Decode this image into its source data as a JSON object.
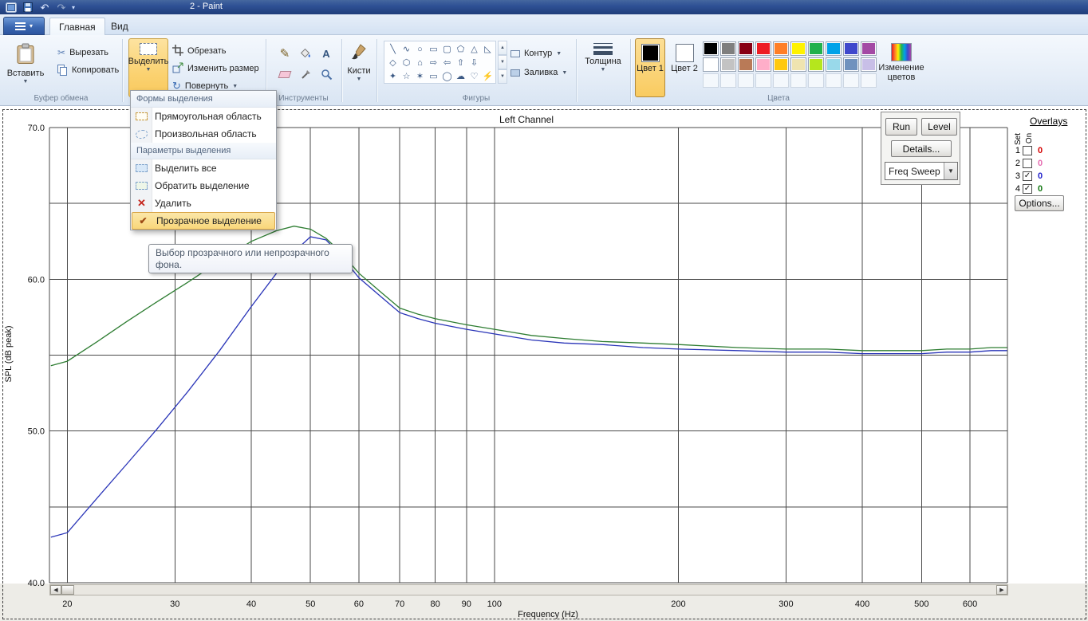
{
  "window": {
    "title": "2 - Paint"
  },
  "tabs": [
    {
      "label": "Главная"
    },
    {
      "label": "Вид"
    }
  ],
  "ribbon": {
    "paste": "Вставить",
    "cut": "Вырезать",
    "copy": "Копировать",
    "clipboard_label": "Буфер обмена",
    "select": "Выделить",
    "crop": "Обрезать",
    "resize": "Изменить размер",
    "rotate": "Повернуть",
    "tools_label": "Инструменты",
    "brushes": "Кисти",
    "shapes_label": "Фигуры",
    "outline": "Контур",
    "fill": "Заливка",
    "size": "Толщина",
    "color1": "Цвет 1",
    "color2": "Цвет 2",
    "edit_colors": "Изменение цветов",
    "colors_label": "Цвета",
    "palette": [
      [
        "#000000",
        "#7f7f7f",
        "#880015",
        "#ed1c24",
        "#ff7f27",
        "#fff200",
        "#22b14c",
        "#00a2e8",
        "#3f48cc",
        "#a349a4"
      ],
      [
        "#ffffff",
        "#c3c3c3",
        "#b97a57",
        "#ffaec9",
        "#ffc90e",
        "#efe4b0",
        "#b5e61d",
        "#99d9ea",
        "#7092be",
        "#c8bfe7"
      ]
    ],
    "shape_rows": [
      [
        "╲",
        "∿",
        "○",
        "▭",
        "▢",
        "⬠",
        "△",
        "◺"
      ],
      [
        "◇",
        "⬡",
        "⌂",
        "⇨",
        "⇦",
        "⇧",
        "⇩"
      ],
      [
        "✦",
        "☆",
        "✶",
        "▭",
        "◯",
        "☁",
        "♡",
        "⚡"
      ]
    ]
  },
  "select_menu": {
    "header1": "Формы выделения",
    "item_rect": "Прямоугольная область",
    "item_free": "Произвольная область",
    "header2": "Параметры выделения",
    "item_all": "Выделить все",
    "item_invert": "Обратить выделение",
    "item_delete": "Удалить",
    "item_transparent": "Прозрачное выделение"
  },
  "tooltip": "Выбор прозрачного или непрозрачного фона.",
  "chart_data": {
    "type": "line",
    "title": "Left Channel",
    "xlabel": "Frequency (Hz)",
    "ylabel": "SPL (dB peak)",
    "x_scale": "log",
    "xlim": [
      18.7,
      691
    ],
    "ylim": [
      40,
      70
    ],
    "grid": true,
    "x_ticks": [
      20,
      30,
      40,
      50,
      60,
      70,
      80,
      90,
      100,
      200,
      300,
      400,
      500,
      600
    ],
    "y_ticks": [
      {
        "v": 70,
        "label": "70.0"
      },
      {
        "v": 60,
        "label": "60.0"
      },
      {
        "v": 50,
        "label": "50.0"
      },
      {
        "v": 40,
        "label": "40.0"
      }
    ],
    "y_grid": [
      40,
      45,
      50,
      55,
      60,
      65,
      70
    ],
    "series": [
      {
        "name": "overlay-3-green",
        "color": "#2e7d32",
        "points": [
          [
            18.8,
            54.3
          ],
          [
            20,
            54.6
          ],
          [
            22.4,
            55.9
          ],
          [
            25,
            57.2
          ],
          [
            28,
            58.5
          ],
          [
            31.5,
            59.8
          ],
          [
            35.5,
            61.2
          ],
          [
            40,
            62.5
          ],
          [
            44,
            63.2
          ],
          [
            47,
            63.5
          ],
          [
            50,
            63.3
          ],
          [
            53,
            62.7
          ],
          [
            56,
            61.8
          ],
          [
            60,
            60.4
          ],
          [
            65,
            59.2
          ],
          [
            70,
            58.1
          ],
          [
            75,
            57.7
          ],
          [
            80,
            57.4
          ],
          [
            90,
            57.0
          ],
          [
            100,
            56.7
          ],
          [
            115,
            56.3
          ],
          [
            130,
            56.1
          ],
          [
            150,
            55.9
          ],
          [
            175,
            55.8
          ],
          [
            200,
            55.7
          ],
          [
            250,
            55.5
          ],
          [
            300,
            55.4
          ],
          [
            350,
            55.4
          ],
          [
            400,
            55.3
          ],
          [
            450,
            55.3
          ],
          [
            500,
            55.3
          ],
          [
            550,
            55.4
          ],
          [
            600,
            55.4
          ],
          [
            650,
            55.5
          ],
          [
            690,
            55.5
          ]
        ]
      },
      {
        "name": "overlay-4-blue",
        "color": "#2a35b8",
        "points": [
          [
            18.8,
            43.0
          ],
          [
            20,
            43.3
          ],
          [
            22.4,
            45.6
          ],
          [
            25,
            47.8
          ],
          [
            28,
            50.1
          ],
          [
            31.5,
            52.6
          ],
          [
            35.5,
            55.3
          ],
          [
            40,
            58.2
          ],
          [
            44,
            60.4
          ],
          [
            47,
            61.8
          ],
          [
            50,
            62.8
          ],
          [
            53,
            62.6
          ],
          [
            56,
            61.6
          ],
          [
            60,
            60.1
          ],
          [
            65,
            58.9
          ],
          [
            70,
            57.8
          ],
          [
            75,
            57.4
          ],
          [
            80,
            57.1
          ],
          [
            90,
            56.7
          ],
          [
            100,
            56.4
          ],
          [
            115,
            56.0
          ],
          [
            130,
            55.8
          ],
          [
            150,
            55.7
          ],
          [
            175,
            55.5
          ],
          [
            200,
            55.4
          ],
          [
            250,
            55.3
          ],
          [
            300,
            55.2
          ],
          [
            350,
            55.2
          ],
          [
            400,
            55.1
          ],
          [
            450,
            55.1
          ],
          [
            500,
            55.1
          ],
          [
            550,
            55.2
          ],
          [
            600,
            55.2
          ],
          [
            650,
            55.3
          ],
          [
            690,
            55.3
          ]
        ]
      }
    ],
    "controls": {
      "run": "Run",
      "level": "Level",
      "details": "Details...",
      "sweep": "Freq Sweep",
      "options": "Options...",
      "overlays_title": "Overlays",
      "col_set": "Set",
      "col_on": "On",
      "rows": [
        {
          "n": "1",
          "checked": false,
          "value": "0",
          "color": "#d40000"
        },
        {
          "n": "2",
          "checked": false,
          "value": "0",
          "color": "#e66bb0"
        },
        {
          "n": "3",
          "checked": true,
          "value": "0",
          "color": "#2222cc"
        },
        {
          "n": "4",
          "checked": true,
          "value": "0",
          "color": "#117711"
        }
      ]
    }
  }
}
